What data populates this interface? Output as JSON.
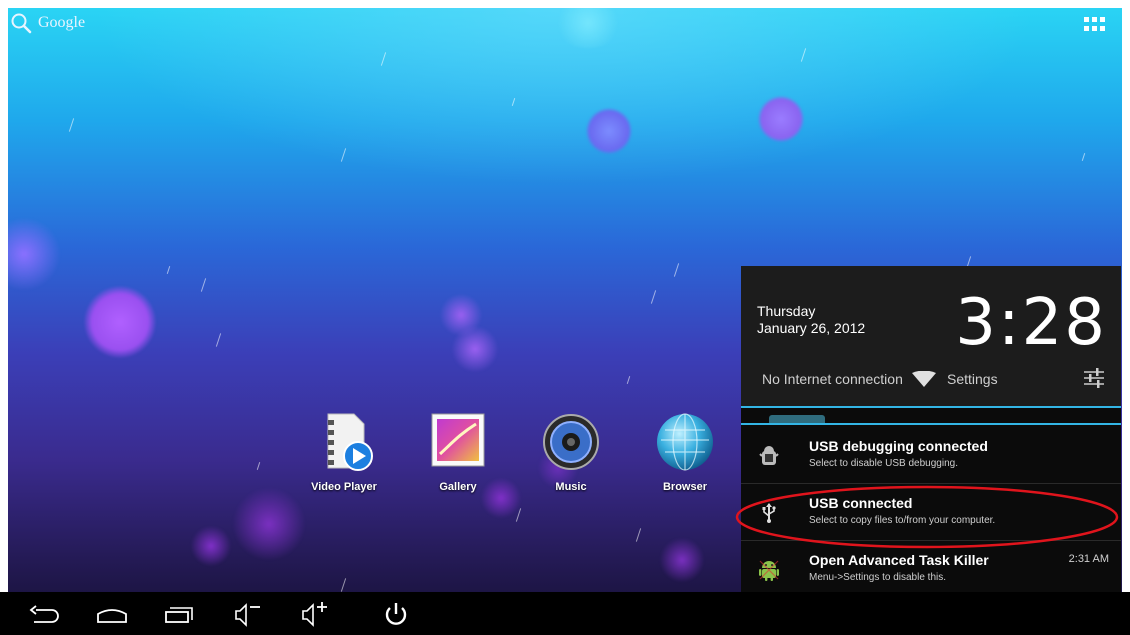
{
  "search": {
    "label": "Google",
    "icon": "search-icon"
  },
  "apps_button": {
    "icon": "apps-grid-icon"
  },
  "apps": [
    {
      "label": "Video Player",
      "icon": "video-player-icon"
    },
    {
      "label": "Gallery",
      "icon": "gallery-icon"
    },
    {
      "label": "Music",
      "icon": "music-icon"
    },
    {
      "label": "Browser",
      "icon": "browser-icon"
    }
  ],
  "panel": {
    "day": "Thursday",
    "date": "January 26, 2012",
    "time": "3:28",
    "network_status": "No Internet connection",
    "settings_label": "Settings",
    "notifications": [
      {
        "title": "USB debugging connected",
        "text": "Select to disable USB debugging.",
        "time": "",
        "icon": "android-debug-icon"
      },
      {
        "title": "USB connected",
        "text": "Select to copy files to/from your computer.",
        "time": "",
        "icon": "usb-icon"
      },
      {
        "title": "Open Advanced Task Killer",
        "text": "Menu->Settings to disable this.",
        "time": "2:31 AM",
        "icon": "android-robot-icon"
      }
    ]
  },
  "navbar": {
    "buttons": [
      "back-icon",
      "home-icon",
      "recent-apps-icon",
      "volume-down-icon",
      "volume-up-icon",
      "power-icon"
    ]
  },
  "colors": {
    "accent": "#33b5e5",
    "highlight": "#e0141c"
  }
}
